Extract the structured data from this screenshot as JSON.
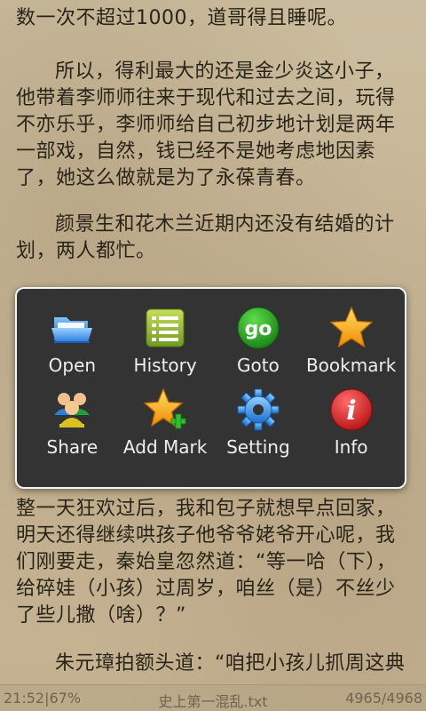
{
  "reader": {
    "paragraphs": [
      "数一次不超过1000，道哥得且睡呢。",
      "所以，得利最大的还是金少炎这小子，他带着李师师往来于现代和过去之间，玩得不亦乐乎，李师师给自己初步地计划是两年一部戏，自然，钱已经不是她考虑地因素了，她这么做就是为了永葆青春。",
      "颜景生和花木兰近期内还没有结婚的计划，两人都忙。",
      "整一天狂欢过后，我和包子就想早点回家，明天还得继续哄孩子他爷爷姥爷开心呢，我们刚要走，秦始皇忽然道：“等一哈（下），给碎娃（小孩）过周岁，咱丝（是）不丝少了些儿撒（啥）？”",
      "朱元璋拍额头道：“咱把小孩儿抓周这典"
    ]
  },
  "menu": {
    "items": [
      {
        "label": "Open",
        "icon": "folder-icon"
      },
      {
        "label": "History",
        "icon": "history-list-icon"
      },
      {
        "label": "Goto",
        "icon": "goto-icon"
      },
      {
        "label": "Bookmark",
        "icon": "star-icon"
      },
      {
        "label": "Share",
        "icon": "people-icon"
      },
      {
        "label": "Add Mark",
        "icon": "add-star-icon"
      },
      {
        "label": "Setting",
        "icon": "gear-icon"
      },
      {
        "label": "Info",
        "icon": "info-icon"
      }
    ],
    "goto_icon_text": "go",
    "info_icon_text": "i"
  },
  "status": {
    "time_battery": "21:52|67%",
    "file_name": "史上第一混乱.txt",
    "page_progress": "4965/4968"
  },
  "colors": {
    "page_background": "#c9b99a",
    "text": "#2a2418",
    "menu_background": "#333333",
    "menu_border": "#f4f4f4",
    "menu_label": "#efefef"
  }
}
